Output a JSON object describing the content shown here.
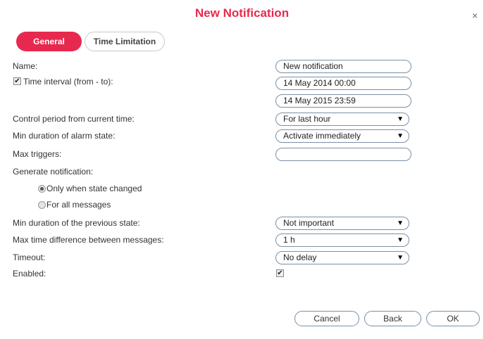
{
  "dialog": {
    "title": "New Notification",
    "close_glyph": "×"
  },
  "tabs": [
    {
      "label": "General",
      "active": true
    },
    {
      "label": "Time Limitation",
      "active": false
    }
  ],
  "form": {
    "name": {
      "label": "Name:",
      "value": "New notification"
    },
    "time_interval": {
      "label": "Time interval (from - to):",
      "checked": true,
      "from": "14 May 2014 00:00",
      "to": "14 May 2015 23:59"
    },
    "control_period": {
      "label": "Control period from current time:",
      "value": "For last hour"
    },
    "min_duration_alarm": {
      "label": "Min duration of alarm state:",
      "value": "Activate immediately"
    },
    "max_triggers": {
      "label": "Max triggers:",
      "value": ""
    },
    "generate_notification": {
      "label": "Generate notification:",
      "options": [
        {
          "label": "Only when state changed",
          "selected": true
        },
        {
          "label": "For all messages",
          "selected": false
        }
      ]
    },
    "min_duration_previous": {
      "label": "Min duration of the previous state:",
      "value": "Not important"
    },
    "max_time_difference": {
      "label": "Max time difference between messages:",
      "value": "1 h"
    },
    "timeout": {
      "label": "Timeout:",
      "value": "No delay"
    },
    "enabled": {
      "label": "Enabled:",
      "checked": true
    }
  },
  "buttons": {
    "cancel": "Cancel",
    "back": "Back",
    "ok": "OK"
  },
  "icons": {
    "check": "✔",
    "dropdown": "▼"
  },
  "colors": {
    "accent": "#e8294f",
    "field_border": "#7a8fa4"
  }
}
